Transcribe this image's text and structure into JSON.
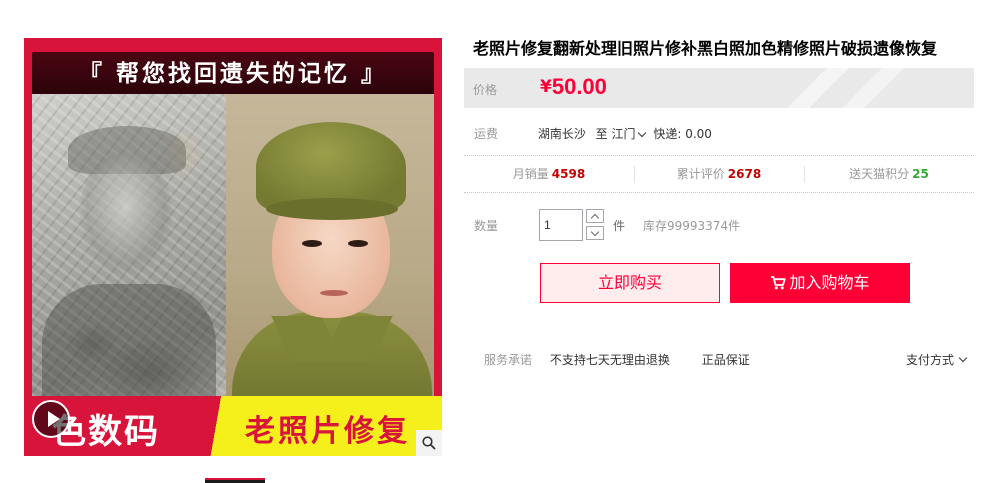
{
  "gallery": {
    "banner_text": "『 帮您找回遗失的记忆 』",
    "strip_left_text": "色数码",
    "strip_right_text": "老照片修复"
  },
  "product": {
    "title": "老照片修复翻新处理旧照片修补黑白照加色精修照片破损遗像恢复",
    "price_label": "价格",
    "currency": "¥",
    "price": "50.00"
  },
  "shipping": {
    "label": "运费",
    "origin": "湖南长沙",
    "to": "至",
    "destination": "江门",
    "express": "快递: 0.00"
  },
  "stats": [
    {
      "label": "月销量",
      "value": "4598"
    },
    {
      "label": "累计评价",
      "value": "2678"
    },
    {
      "label": "送天猫积分",
      "value": "25"
    }
  ],
  "quantity": {
    "label": "数量",
    "value": "1",
    "unit": "件",
    "stock": "库存99993374件"
  },
  "actions": {
    "buy_now": "立即购买",
    "add_to_cart": "加入购物车"
  },
  "service": {
    "label": "服务承诺",
    "items": [
      "不支持七天无理由退换",
      "正品保证"
    ],
    "payment": "支付方式"
  },
  "colors": {
    "accent": "#ff0036",
    "stat_red": "#c40000",
    "stat_green": "#33aa33",
    "banner_red": "#d8143a",
    "strip_yellow": "#f5ef1c"
  },
  "icons": [
    "play-icon",
    "zoom-icon",
    "cart-icon",
    "chevron-down-icon"
  ]
}
